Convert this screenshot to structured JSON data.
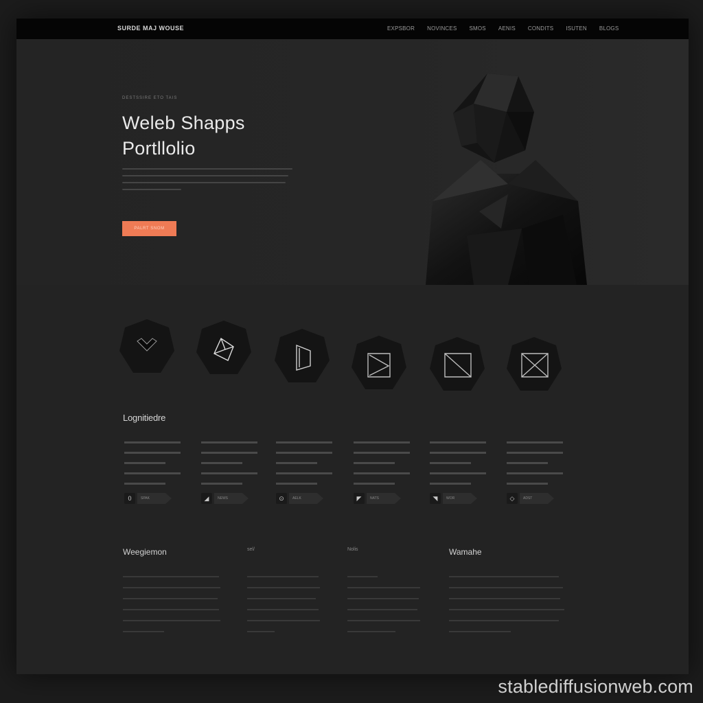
{
  "topbar": {
    "brand": "SURDE MAJ WOUSE",
    "nav": [
      "EXPSBOR",
      "NOVINCES",
      "SMOS",
      "AENIS",
      "CONDITS",
      "ISUTEN",
      "BLOGS"
    ]
  },
  "hero": {
    "eyebrow": "DESTSSIRE ETO TAIS",
    "title_line1": "Weleb Shapps",
    "title_line2": "Portllolio",
    "cta_label": "PALRT SNOM",
    "accent": "#ef7b55"
  },
  "icons": [
    {
      "icon": "heart-icon"
    },
    {
      "icon": "cube-icon"
    },
    {
      "icon": "fold-icon"
    },
    {
      "icon": "play-box-icon"
    },
    {
      "icon": "slash-box-icon"
    },
    {
      "icon": "x-box-icon"
    }
  ],
  "section": {
    "label": "Lognitiedre"
  },
  "columns": [
    {
      "chip_glyph": "0",
      "chip_text": "SPAK"
    },
    {
      "chip_glyph": "◢",
      "chip_text": "NEWS"
    },
    {
      "chip_glyph": "⊙",
      "chip_text": "AELK"
    },
    {
      "chip_glyph": "◤",
      "chip_text": "NATS"
    },
    {
      "chip_glyph": "◥",
      "chip_text": "WOR"
    },
    {
      "chip_glyph": "◇",
      "chip_text": "ADST"
    }
  ],
  "footer": [
    {
      "title": "Weegiemon"
    },
    {
      "title": "sel/"
    },
    {
      "title": "Nolis"
    },
    {
      "title": "Wamahe"
    }
  ],
  "watermark": "stablediffusionweb.com"
}
